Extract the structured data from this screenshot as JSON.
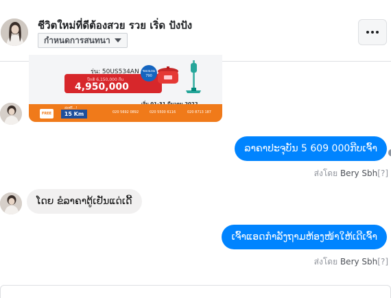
{
  "header": {
    "title": "ชีวิตใหม่ที่ดีต้องสวย รวย เริ่ด ปังปัง",
    "conversation_menu_label": "กำหนดการสนทนา",
    "more_icon": "more-horizontal-icon"
  },
  "promo": {
    "model": "รุ่น: 50US534AN",
    "old_price": "ปีกติ 6,150,000 กีบ",
    "price": "4,950,000",
    "badge": "ของแถม 790",
    "period": "เริ่ม 01-31 มีนาคม 2022",
    "free_label": "FREE",
    "distance_head": "ส่งฟรี...!",
    "distance": "15 Km",
    "contacts": [
      "020 5692 0892",
      "020 5500 6116",
      "020 8713 187"
    ]
  },
  "messages": [
    {
      "direction": "out",
      "text": "ລາຄາປະຈຸບັນ 5 609 000ກີບເຈົ້າ",
      "sent_by_prefix": "ส่งโดย",
      "sent_by_name": "Bery Sbh",
      "marker": "[?]"
    },
    {
      "direction": "in",
      "text": "ໂດຍ ຂໍລາຄາຕູ້ເຢັນແດ່ເດີ້"
    },
    {
      "direction": "out",
      "text": "ເຈົ້າແອດກຳລັງຖາມຫ້ອງໜ້າໃຫ້ເດີເຈົ້າ",
      "sent_by_prefix": "ส่งโดย",
      "sent_by_name": "Bery Sbh",
      "marker": "[?]"
    }
  ],
  "colors": {
    "outgoing_bubble": "#0084ff",
    "incoming_bubble": "#f1f0f0",
    "promo_red": "#d7272b",
    "promo_orange": "#f07a1a"
  }
}
